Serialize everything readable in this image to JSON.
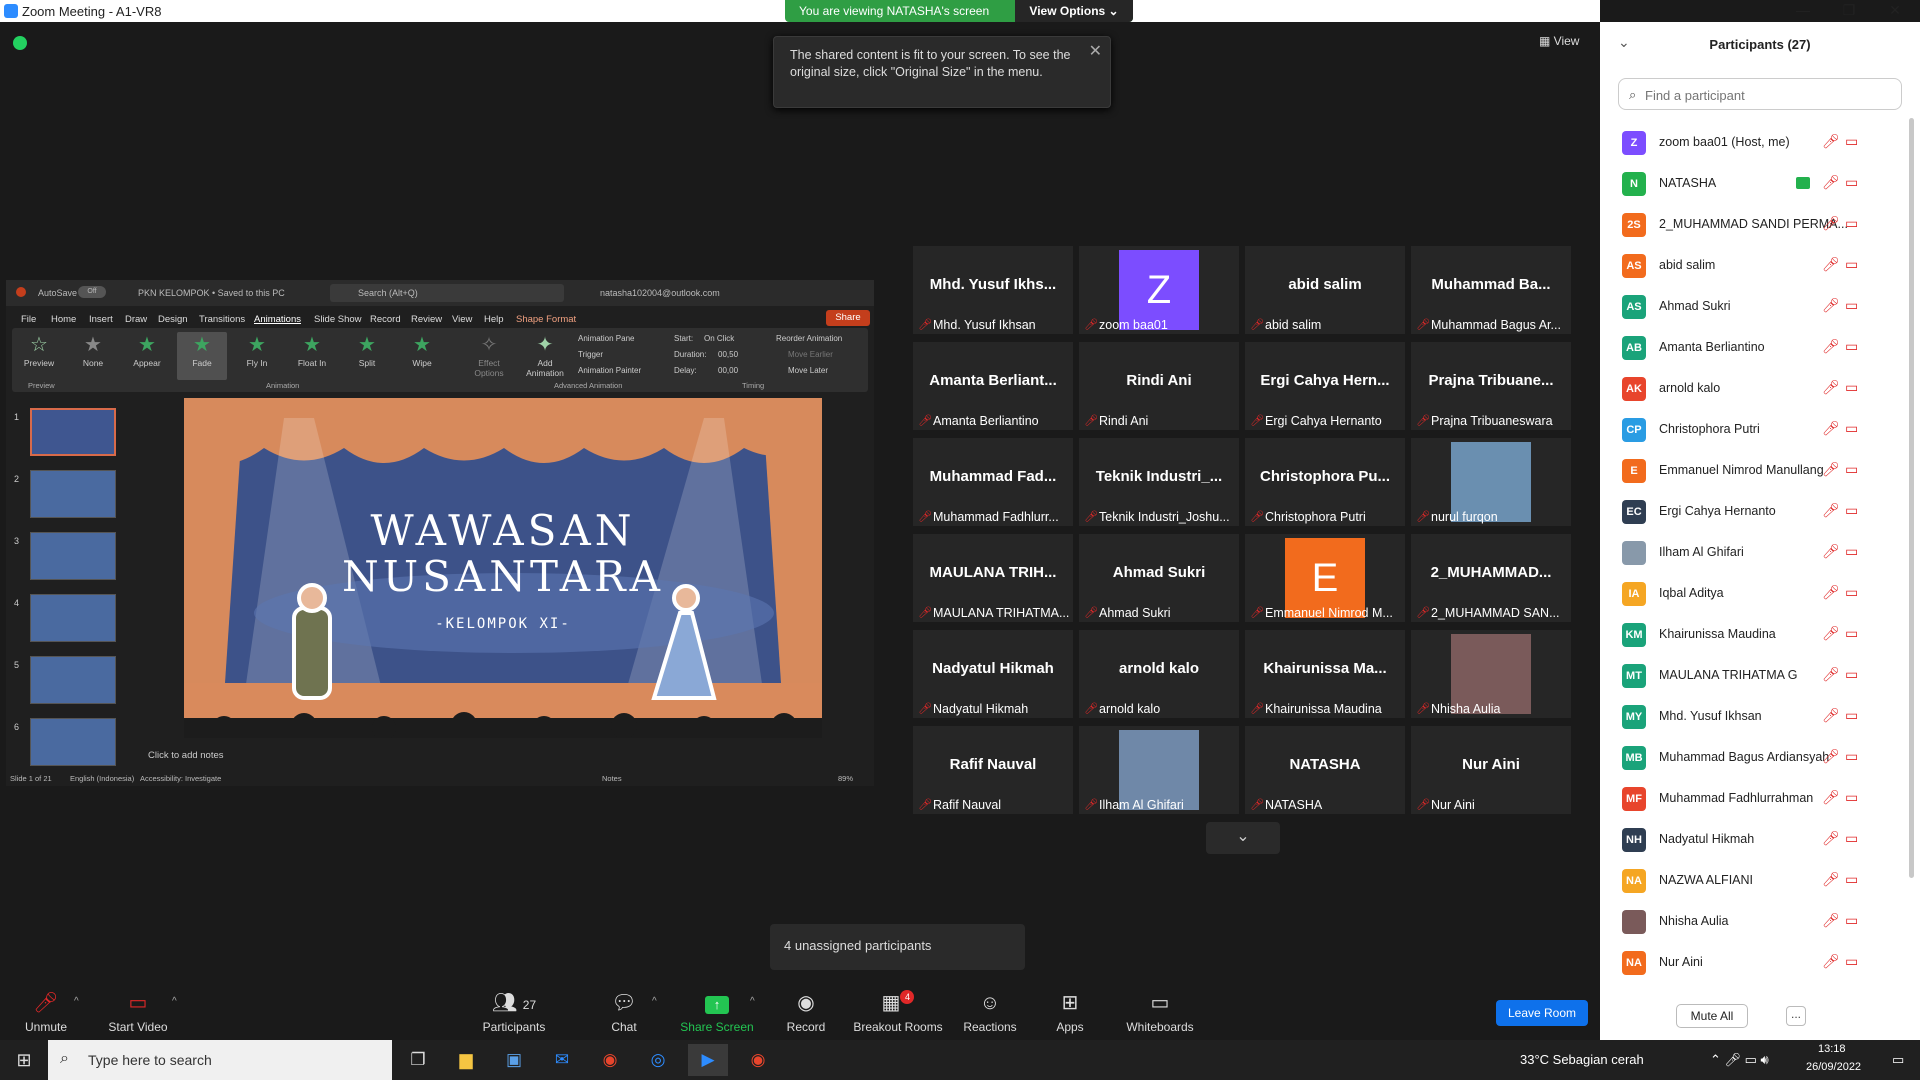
{
  "window": {
    "title": "Zoom Meeting - A1-VR8"
  },
  "banner": {
    "viewing": "You are viewing NATASHA's screen",
    "view_options": "View Options"
  },
  "toast": {
    "text": "The shared content is fit to your screen. To see the original size, click \"Original Size\" in the menu."
  },
  "view_button": "View",
  "ppt": {
    "autosave": "AutoSave",
    "autosave_state": "Off",
    "file": "PKN KELOMPOK • Saved to this PC",
    "search": "Search (Alt+Q)",
    "account": "natasha102004@outlook.com",
    "menu": [
      "File",
      "Home",
      "Insert",
      "Draw",
      "Design",
      "Transitions",
      "Animations",
      "Slide Show",
      "Record",
      "Review",
      "View",
      "Help",
      "Shape Format"
    ],
    "share": "Share",
    "animations": [
      "None",
      "Appear",
      "Fade",
      "Fly In",
      "Float In",
      "Split",
      "Wipe"
    ],
    "preview": "Preview",
    "effect_options": "Effect Options",
    "add_animation": "Add Animation",
    "animation_pane": "Animation Pane",
    "trigger": "Trigger",
    "animation_painter": "Animation Painter",
    "start_label": "Start:",
    "start_value": "On Click",
    "duration_label": "Duration:",
    "duration_value": "00,50",
    "delay_label": "Delay:",
    "delay_value": "00,00",
    "reorder": "Reorder Animation",
    "move_earlier": "Move Earlier",
    "move_later": "Move Later",
    "groups": [
      "Preview",
      "Animation",
      "Advanced Animation",
      "Timing"
    ],
    "slide_title1": "WAWASAN",
    "slide_title2": "NUSANTARA",
    "slide_sub": "-KELOMPOK XI-",
    "notes": "Click to add notes",
    "status_slide": "Slide 1 of 21",
    "status_lang": "English (Indonesia)",
    "status_access": "Accessibility: Investigate",
    "status_notes": "Notes",
    "zoom": "89%",
    "thumb_nums": [
      "1",
      "2",
      "3",
      "4",
      "5",
      "6"
    ]
  },
  "tiles": [
    {
      "big": "Mhd. Yusuf Ikhs...",
      "name": "Mhd. Yusuf Ikhsan"
    },
    {
      "avatar": "Z",
      "avatar_color": "#7c4dff",
      "name": "zoom baa01"
    },
    {
      "big": "abid salim",
      "name": "abid salim"
    },
    {
      "big": "Muhammad Ba...",
      "name": "Muhammad Bagus Ar..."
    },
    {
      "big": "Amanta Berliant...",
      "name": "Amanta Berliantino"
    },
    {
      "big": "Rindi Ani",
      "name": "Rindi Ani"
    },
    {
      "big": "Ergi Cahya Hern...",
      "name": "Ergi Cahya Hernanto"
    },
    {
      "big": "Prajna Tribuane...",
      "name": "Prajna Tribuaneswara"
    },
    {
      "big": "Muhammad Fad...",
      "name": "Muhammad Fadhlurr..."
    },
    {
      "big": "Teknik Industri_...",
      "name": "Teknik Industri_Joshu..."
    },
    {
      "big": "Christophora Pu...",
      "name": "Christophora Putri"
    },
    {
      "photo": "#6a8fb0",
      "name": "nurul furqon"
    },
    {
      "big": "MAULANA TRIH...",
      "name": "MAULANA TRIHATMA..."
    },
    {
      "big": "Ahmad Sukri",
      "name": "Ahmad Sukri"
    },
    {
      "avatar": "E",
      "avatar_color": "#f26b1d",
      "name": "Emmanuel Nimrod M..."
    },
    {
      "big": "2_MUHAMMAD...",
      "name": "2_MUHAMMAD SAN..."
    },
    {
      "big": "Nadyatul Hikmah",
      "name": "Nadyatul Hikmah"
    },
    {
      "big": "arnold kalo",
      "name": "arnold kalo"
    },
    {
      "big": "Khairunissa Ma...",
      "name": "Khairunissa Maudina"
    },
    {
      "photo": "#7a5a5a",
      "name": "Nhisha Aulia"
    },
    {
      "big": "Rafif Nauval",
      "name": "Rafif Nauval"
    },
    {
      "photo": "#6f88a8",
      "name": "Ilham Al Ghifari"
    },
    {
      "big": "NATASHA",
      "name": "NATASHA"
    },
    {
      "big": "Nur Aini",
      "name": "Nur Aini"
    }
  ],
  "unassigned": "4 unassigned participants",
  "toolbar": {
    "unmute": "Unmute",
    "start_video": "Start Video",
    "participants": "Participants",
    "participants_count": "27",
    "chat": "Chat",
    "share_screen": "Share Screen",
    "record": "Record",
    "breakout_rooms": "Breakout Rooms",
    "breakout_badge": "4",
    "reactions": "Reactions",
    "apps": "Apps",
    "whiteboards": "Whiteboards",
    "leave": "Leave Room"
  },
  "panel": {
    "title": "Participants (27)",
    "search_placeholder": "Find a participant",
    "mute_all": "Mute All",
    "more": "...",
    "participants": [
      {
        "initials": "Z",
        "color": "#7c4dff",
        "name": "zoom baa01 (Host, me)"
      },
      {
        "initials": "N",
        "color": "#23b14d",
        "name": "NATASHA",
        "sharing": true
      },
      {
        "initials": "2S",
        "color": "#f26b1d",
        "name": "2_MUHAMMAD SANDI PERMA..."
      },
      {
        "initials": "AS",
        "color": "#f26b1d",
        "name": "abid salim"
      },
      {
        "initials": "AS",
        "color": "#1aa37a",
        "name": "Ahmad Sukri"
      },
      {
        "initials": "AB",
        "color": "#1aa37a",
        "name": "Amanta Berliantino"
      },
      {
        "initials": "AK",
        "color": "#e8452c",
        "name": "arnold kalo"
      },
      {
        "initials": "CP",
        "color": "#2a9ce3",
        "name": "Christophora Putri"
      },
      {
        "initials": "E",
        "color": "#f26b1d",
        "name": "Emmanuel Nimrod Manullang"
      },
      {
        "initials": "EC",
        "color": "#2f3e52",
        "name": "Ergi Cahya Hernanto"
      },
      {
        "initials": "",
        "color": "#8899aa",
        "name": "Ilham Al Ghifari",
        "photo": true
      },
      {
        "initials": "IA",
        "color": "#f5a623",
        "name": "Iqbal Aditya"
      },
      {
        "initials": "KM",
        "color": "#1aa37a",
        "name": "Khairunissa Maudina"
      },
      {
        "initials": "MT",
        "color": "#1aa37a",
        "name": "MAULANA TRIHATMA G"
      },
      {
        "initials": "MY",
        "color": "#1aa37a",
        "name": "Mhd. Yusuf Ikhsan"
      },
      {
        "initials": "MB",
        "color": "#1aa37a",
        "name": "Muhammad Bagus Ardiansyah"
      },
      {
        "initials": "MF",
        "color": "#e8452c",
        "name": "Muhammad Fadhlurrahman"
      },
      {
        "initials": "NH",
        "color": "#2f3e52",
        "name": "Nadyatul Hikmah"
      },
      {
        "initials": "NA",
        "color": "#f5a623",
        "name": "NAZWA ALFIANI"
      },
      {
        "initials": "",
        "color": "#7a5a5a",
        "name": "Nhisha Aulia",
        "photo": true
      },
      {
        "initials": "NA",
        "color": "#f26b1d",
        "name": "Nur Aini"
      }
    ]
  },
  "taskbar": {
    "search": "Type here to search",
    "weather": "33°C  Sebagian cerah",
    "time": "13:18",
    "date": "26/09/2022"
  }
}
